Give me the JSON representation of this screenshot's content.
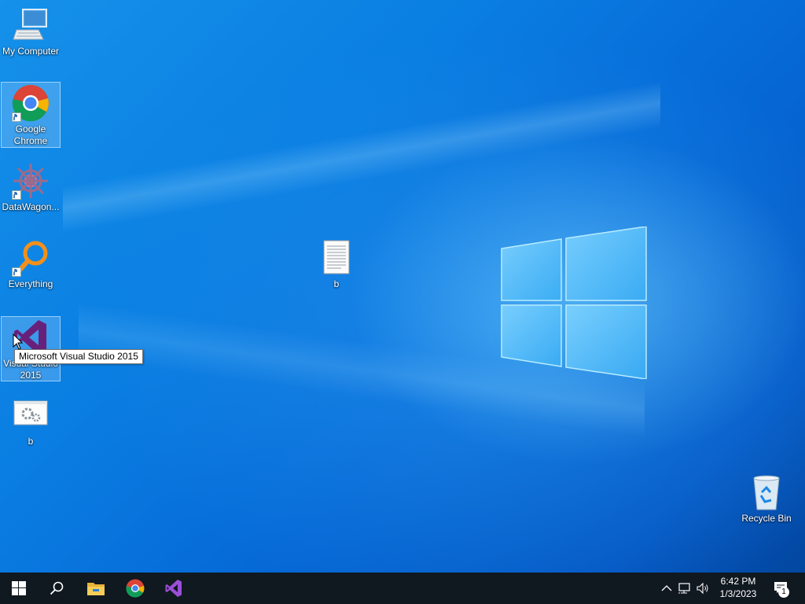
{
  "desktop": {
    "icons": [
      {
        "label": "My Computer",
        "icon": "computer-icon"
      },
      {
        "label": "Google\nChrome",
        "icon": "chrome-icon"
      },
      {
        "label": "DataWagon...",
        "icon": "datawagon-icon"
      },
      {
        "label": "Everything",
        "icon": "everything-search-icon"
      },
      {
        "label": "Visual Studio\n2015",
        "icon": "visual-studio-icon"
      },
      {
        "label": "b",
        "icon": "settings-file-icon"
      },
      {
        "label": "b",
        "icon": "text-document-icon"
      },
      {
        "label": "Recycle Bin",
        "icon": "recycle-bin-icon"
      }
    ],
    "tooltip": "Microsoft Visual Studio 2015"
  },
  "taskbar": {
    "buttons": [
      "start-icon",
      "search-icon",
      "file-explorer-icon",
      "chrome-icon",
      "visual-studio-icon"
    ],
    "tray": [
      "chevron-up-icon",
      "network-icon",
      "volume-icon"
    ],
    "clock": {
      "time": "6:42 PM",
      "date": "1/3/2023"
    },
    "notifications": {
      "count": "1"
    }
  },
  "colors": {
    "taskbar": "#101820",
    "desktop_accent": "#0a7ee2"
  }
}
